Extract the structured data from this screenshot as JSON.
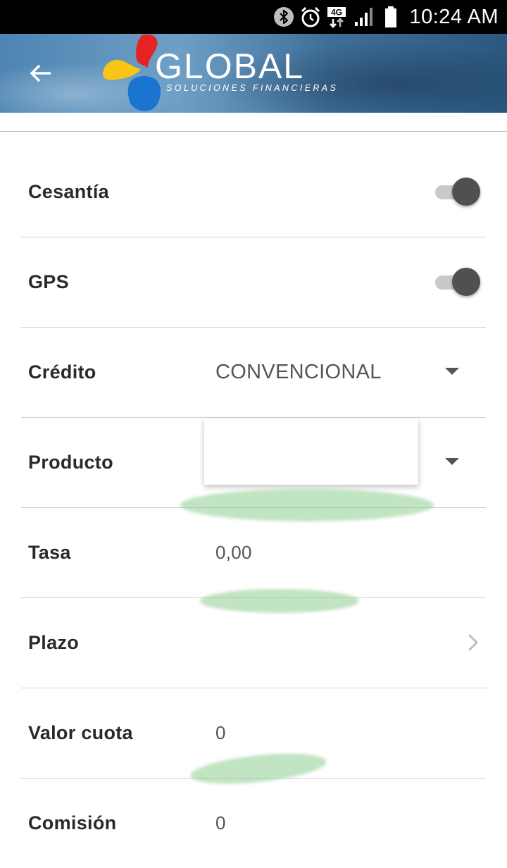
{
  "status_bar": {
    "time": "10:24 AM",
    "network_label": "4G",
    "icons": [
      "bluetooth-icon",
      "alarm-icon",
      "network-4g-icon",
      "signal-icon",
      "battery-icon"
    ]
  },
  "header": {
    "logo_text": "GLOBAL",
    "logo_subtitle": "SOLUCIONES FINANCIERAS",
    "back_icon": "arrow-back-icon"
  },
  "form": {
    "rows": [
      {
        "label": "Cesantía",
        "type": "toggle",
        "value": true
      },
      {
        "label": "GPS",
        "type": "toggle",
        "value": true
      },
      {
        "label": "Crédito",
        "type": "select",
        "value": "CONVENCIONAL"
      },
      {
        "label": "Producto",
        "type": "select",
        "value": ""
      },
      {
        "label": "Tasa",
        "type": "text",
        "value": "0,00"
      },
      {
        "label": "Plazo",
        "type": "nav",
        "value": ""
      },
      {
        "label": "Valor cuota",
        "type": "text",
        "value": "0"
      },
      {
        "label": "Comisión",
        "type": "text",
        "value": "0"
      }
    ]
  },
  "colors": {
    "status_bar_bg": "#000000",
    "toggle_thumb": "#505050",
    "toggle_track": "#c9c9c9",
    "divider": "#d0d0d0",
    "logo_red": "#e52421",
    "logo_yellow": "#f7c417",
    "logo_blue": "#1b75d0"
  }
}
